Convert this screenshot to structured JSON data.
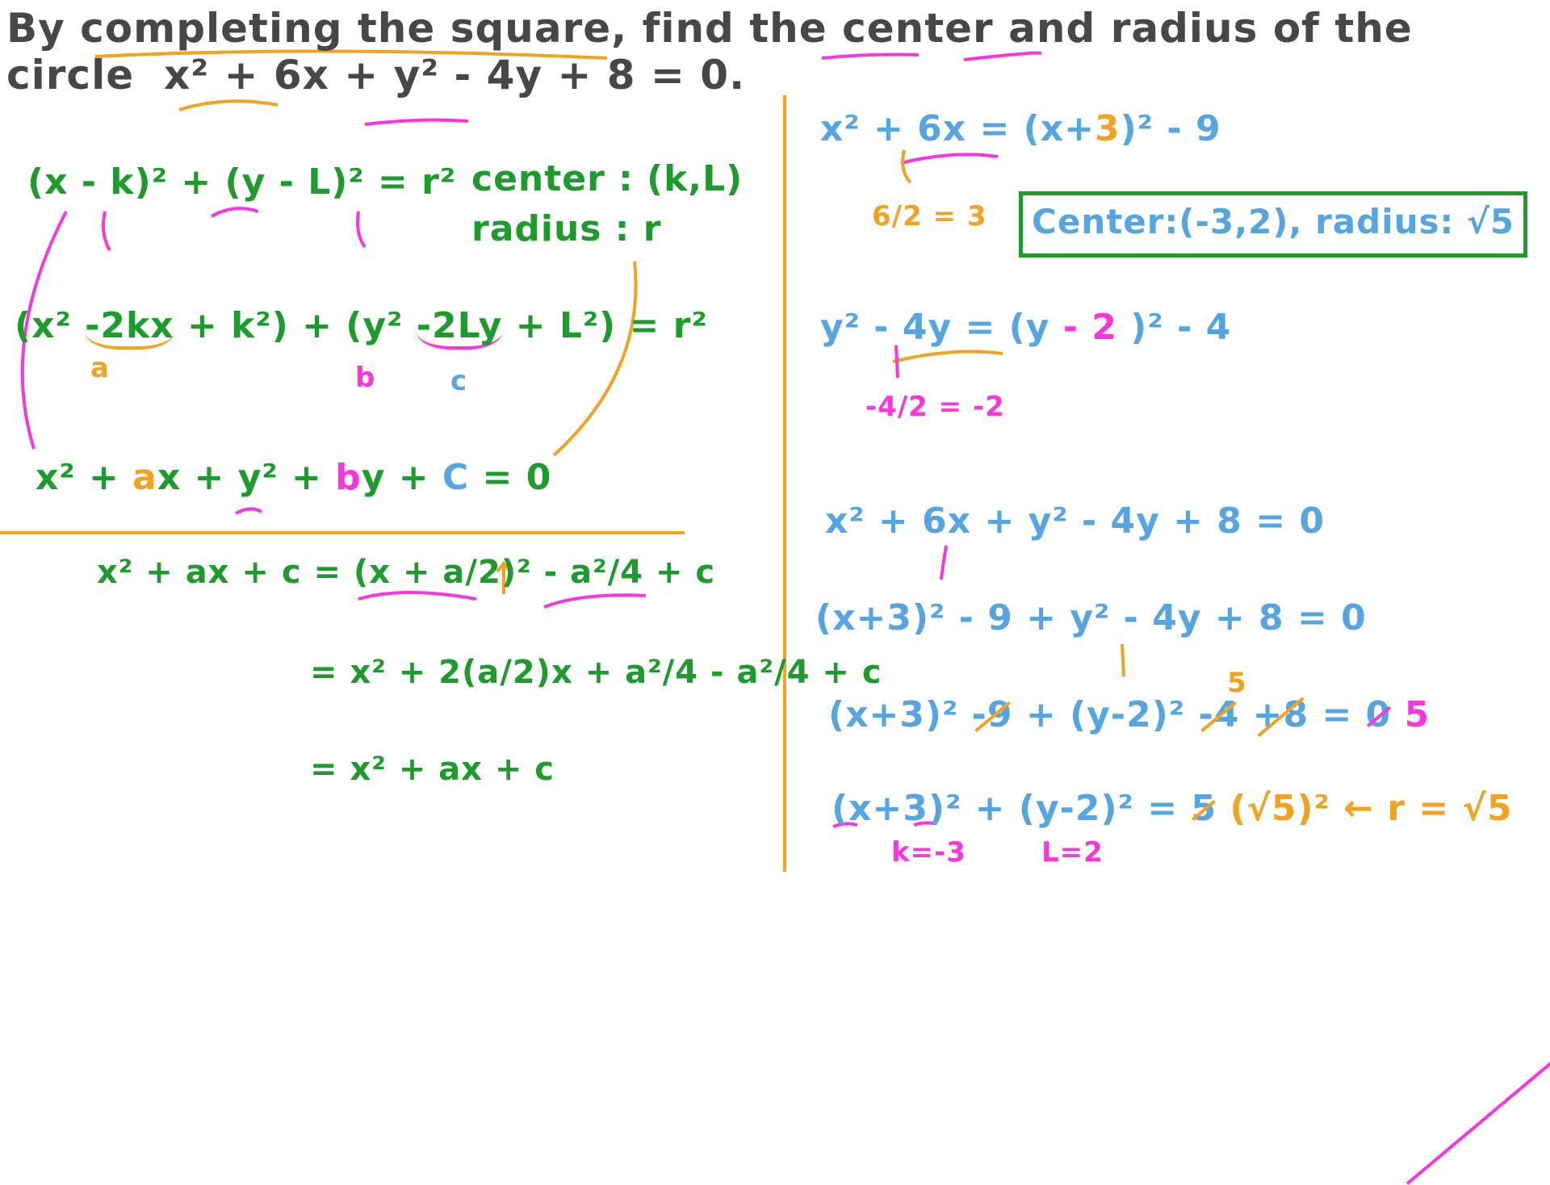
{
  "colors": {
    "text": "#474747",
    "orange": "#f2a21e",
    "magenta": "#fb35de",
    "green": "#1d9b2c",
    "blue": "#56a5e3"
  },
  "question": {
    "line1_parts": [
      "By",
      "completing the square",
      ", find the",
      "center",
      "and",
      "radius",
      "of the"
    ],
    "line2_prefix": "circle",
    "equation_x": "x² + 6x",
    "equation_plus": "+",
    "equation_y": "y² - 4y",
    "equation_rest": "+ 8 = 0."
  },
  "left": {
    "standard_form": "(x - k)² + (y - L)² = r²",
    "center_label": "center : (k,L)",
    "radius_label": "radius : r",
    "expanded_form": {
      "part1": "(x² ",
      "a_term": "-2kx",
      "part2": " + ",
      "c1_term": "k²",
      "part3": ") + (y² ",
      "b_term": "-2Ly",
      "part4": " + ",
      "c2_term": "L²",
      "part5": ") = ",
      "c3_term": "r²"
    },
    "labels": {
      "a": "a",
      "b": "b",
      "c": "c"
    },
    "general_form": {
      "x2": "x² + ",
      "a": "a",
      "x": "x + y² + ",
      "b": "b",
      "y": "y + ",
      "c": "C",
      "rhs": " = 0"
    },
    "derivation": {
      "line1_lhs": "x² + ax + c =",
      "line1_square": "(x + a/2)²",
      "line1_rest": "- a²/4 + c",
      "line2": "= x² + 2(a/2)x + a²/4 - a²/4 + c",
      "line3": "= x² + ax + c"
    }
  },
  "right": {
    "step_x": {
      "lhs": "x² + 6x =",
      "open": "(x+",
      "three": "3",
      "close": ")²",
      "rest": " - 9"
    },
    "half_x": "6/2 = 3",
    "answer_box": "Center:(-3,2), radius: √5",
    "step_y": {
      "lhs": "y² - 4y =",
      "open": "(y ",
      "two": "- 2",
      "close": " )²",
      "rest": " - 4"
    },
    "half_y": "-4/2 = -2",
    "eq1": "x² + 6x + y² - 4y + 8 = 0",
    "eq2": "(x+3)² - 9 + y² - 4y + 8 = 0",
    "eq3": {
      "start": "(x+3)² ",
      "s1": "-9",
      "mid": " + (y-2)² ",
      "s2": "-4",
      "sp": " ",
      "s3": "+8",
      "eq": " = ",
      "s4": "0",
      "new": " 5",
      "above": "5"
    },
    "eq4": {
      "lhs": "(x+3)² + (y-2)² = ",
      "struck": "5",
      "rhs": " (√5)²",
      "note": "← r = √5"
    },
    "k_value": "k=-3",
    "l_value": "L=2"
  }
}
